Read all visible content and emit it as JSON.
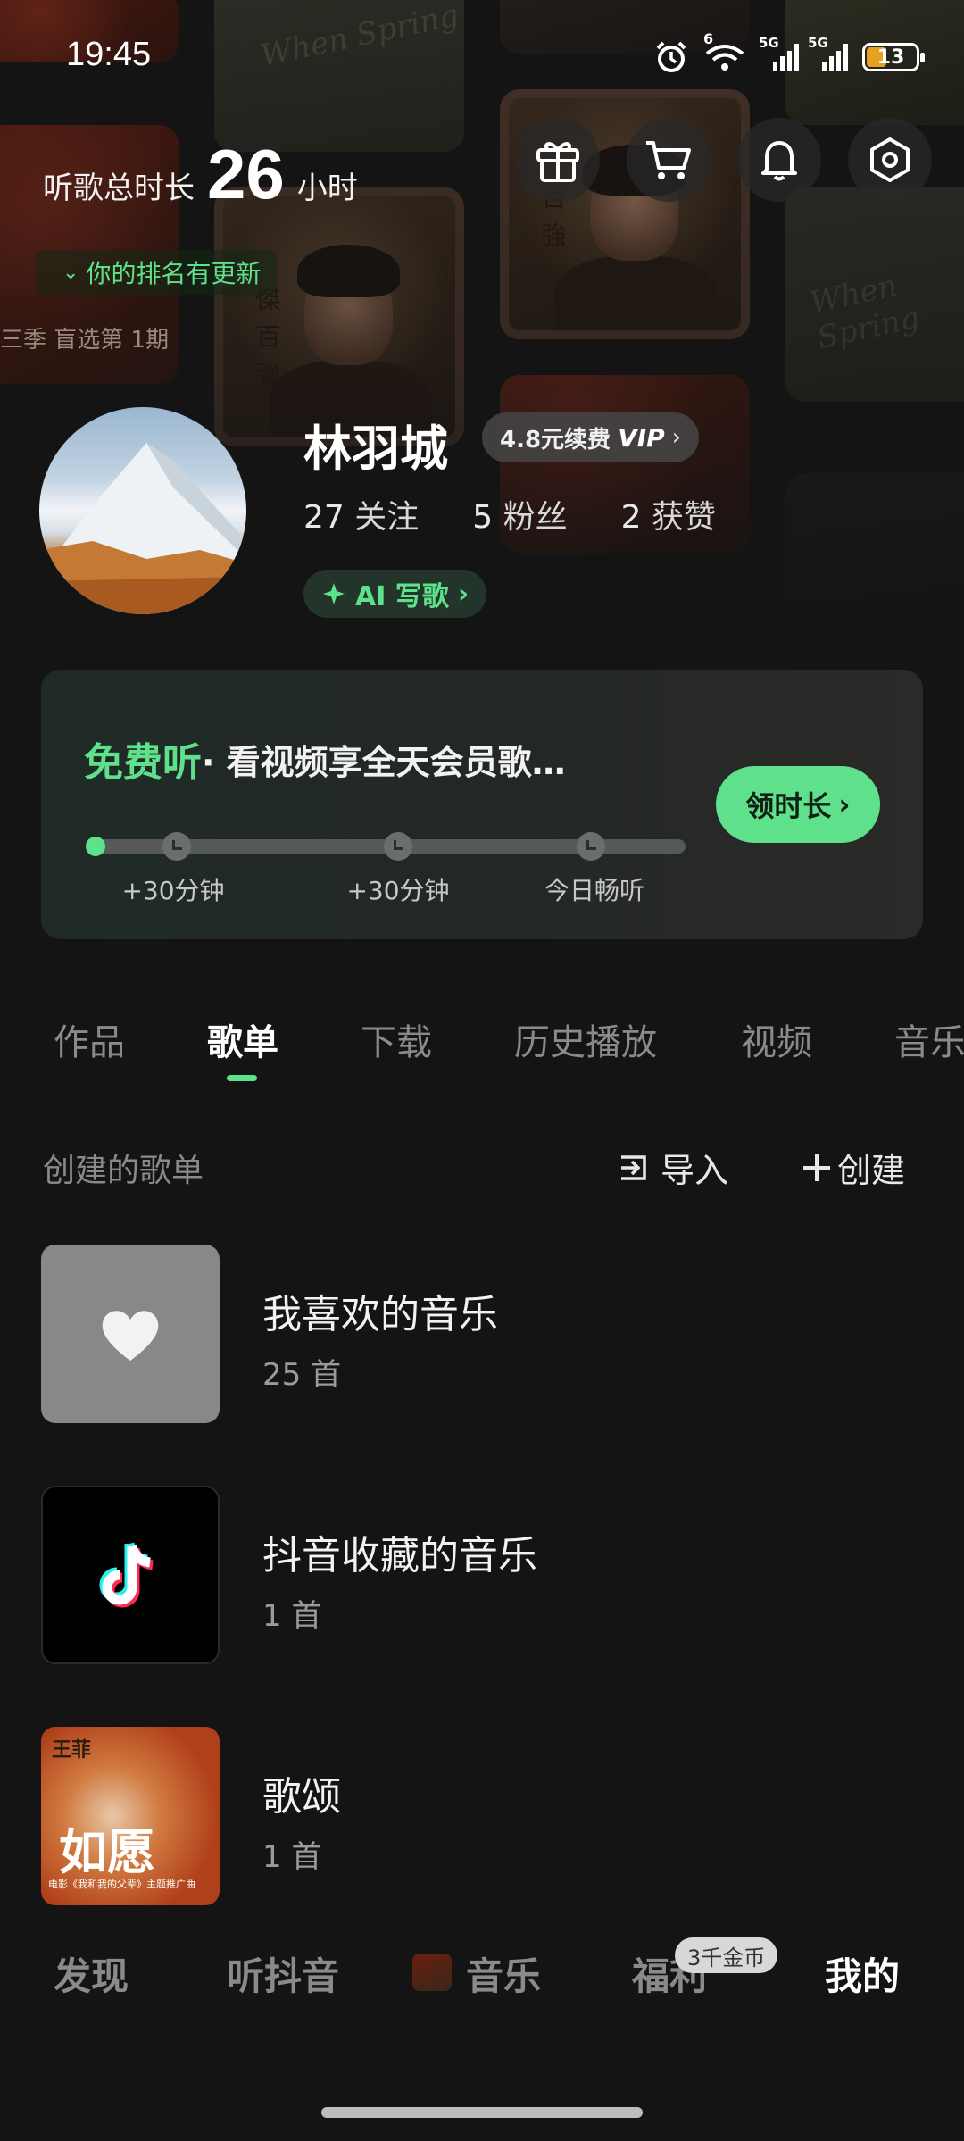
{
  "status_bar": {
    "time": "19:45",
    "battery": "13",
    "net1": "5G",
    "net2": "5G",
    "wifi_badge": "6"
  },
  "header": {
    "listen_label": "听歌总时长",
    "listen_hours": "26",
    "listen_unit": "小时",
    "rank_update": "你的排名有更新",
    "bg_caption": "三季 盲选第 1期",
    "icons": [
      "gift-icon",
      "cart-icon",
      "bell-icon",
      "settings-icon"
    ]
  },
  "profile": {
    "name": "林羽城",
    "vip_price": "4.8元续费",
    "vip_tag": "VIP",
    "following_count": "27",
    "following_label": "关注",
    "fans_count": "5",
    "fans_label": "粉丝",
    "likes_count": "2",
    "likes_label": "获赞",
    "ai_write": "AI 写歌"
  },
  "free_listen": {
    "title_green": "免费听",
    "title_rest": "· 看视频享全天会员歌…",
    "claim_button": "领时长",
    "progress": 0,
    "milestones": [
      "+30分钟",
      "+30分钟",
      "今日畅听"
    ]
  },
  "tabs": {
    "items": [
      "作品",
      "歌单",
      "下载",
      "历史播放",
      "视频",
      "音乐"
    ],
    "active": "歌单"
  },
  "playlists": {
    "section_title": "创建的歌单",
    "import_label": "导入",
    "create_label": "创建",
    "items": [
      {
        "name": "我喜欢的音乐",
        "count": "25 首"
      },
      {
        "name": "抖音收藏的音乐",
        "count": "1 首"
      },
      {
        "name": "歌颂",
        "count": "1 首"
      }
    ],
    "cover3_text": "如愿",
    "cover3_top": "王菲",
    "cover3_caption": "电影《我和我的父辈》主题推广曲"
  },
  "bottom_nav": {
    "items": [
      "发现",
      "听抖音",
      "音乐",
      "福利",
      "我的"
    ],
    "active": "我的",
    "coin_badge": "3千金币"
  },
  "colors": {
    "accent": "#5fe08a",
    "background": "#141414",
    "battery": "#e8a020"
  }
}
